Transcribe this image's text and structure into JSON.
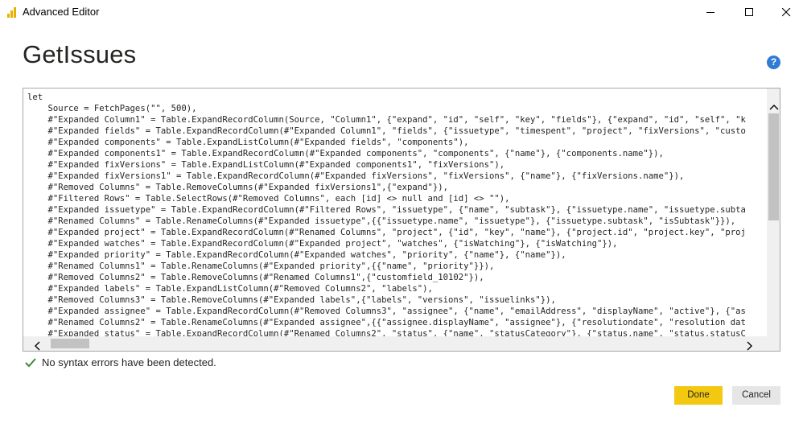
{
  "window": {
    "title": "Advanced Editor",
    "icon": "power-bi-icon"
  },
  "header": {
    "title": "GetIssues",
    "help_icon": "?"
  },
  "editor": {
    "lines": [
      "let",
      "    Source = FetchPages(\"\", 500),",
      "    #\"Expanded Column1\" = Table.ExpandRecordColumn(Source, \"Column1\", {\"expand\", \"id\", \"self\", \"key\", \"fields\"}, {\"expand\", \"id\", \"self\", \"k",
      "    #\"Expanded fields\" = Table.ExpandRecordColumn(#\"Expanded Column1\", \"fields\", {\"issuetype\", \"timespent\", \"project\", \"fixVersions\", \"custo",
      "    #\"Expanded components\" = Table.ExpandListColumn(#\"Expanded fields\", \"components\"),",
      "    #\"Expanded components1\" = Table.ExpandRecordColumn(#\"Expanded components\", \"components\", {\"name\"}, {\"components.name\"}),",
      "    #\"Expanded fixVersions\" = Table.ExpandListColumn(#\"Expanded components1\", \"fixVersions\"),",
      "    #\"Expanded fixVersions1\" = Table.ExpandRecordColumn(#\"Expanded fixVersions\", \"fixVersions\", {\"name\"}, {\"fixVersions.name\"}),",
      "    #\"Removed Columns\" = Table.RemoveColumns(#\"Expanded fixVersions1\",{\"expand\"}),",
      "    #\"Filtered Rows\" = Table.SelectRows(#\"Removed Columns\", each [id] <> null and [id] <> \"\"),",
      "    #\"Expanded issuetype\" = Table.ExpandRecordColumn(#\"Filtered Rows\", \"issuetype\", {\"name\", \"subtask\"}, {\"issuetype.name\", \"issuetype.subta",
      "    #\"Renamed Columns\" = Table.RenameColumns(#\"Expanded issuetype\",{{\"issuetype.name\", \"issuetype\"}, {\"issuetype.subtask\", \"isSubtask\"}}),",
      "    #\"Expanded project\" = Table.ExpandRecordColumn(#\"Renamed Columns\", \"project\", {\"id\", \"key\", \"name\"}, {\"project.id\", \"project.key\", \"proj",
      "    #\"Expanded watches\" = Table.ExpandRecordColumn(#\"Expanded project\", \"watches\", {\"isWatching\"}, {\"isWatching\"}),",
      "    #\"Expanded priority\" = Table.ExpandRecordColumn(#\"Expanded watches\", \"priority\", {\"name\"}, {\"name\"}),",
      "    #\"Renamed Columns1\" = Table.RenameColumns(#\"Expanded priority\",{{\"name\", \"priority\"}}),",
      "    #\"Removed Columns2\" = Table.RemoveColumns(#\"Renamed Columns1\",{\"customfield_10102\"}),",
      "    #\"Expanded labels\" = Table.ExpandListColumn(#\"Removed Columns2\", \"labels\"),",
      "    #\"Removed Columns3\" = Table.RemoveColumns(#\"Expanded labels\",{\"labels\", \"versions\", \"issuelinks\"}),",
      "    #\"Expanded assignee\" = Table.ExpandRecordColumn(#\"Removed Columns3\", \"assignee\", {\"name\", \"emailAddress\", \"displayName\", \"active\"}, {\"as",
      "    #\"Renamed Columns2\" = Table.RenameColumns(#\"Expanded assignee\",{{\"assignee.displayName\", \"assignee\"}, {\"resolutiondate\", \"resolution dat",
      "    #\"Expanded status\" = Table.ExpandRecordColumn(#\"Renamed Columns2\", \"status\", {\"name\", \"statusCategory\"}, {\"status.name\", \"status.statusC"
    ]
  },
  "status": {
    "icon": "check-icon",
    "color": "#3d8b37",
    "message": "No syntax errors have been detected."
  },
  "buttons": {
    "done": "Done",
    "cancel": "Cancel",
    "accent": "#f2c811"
  }
}
